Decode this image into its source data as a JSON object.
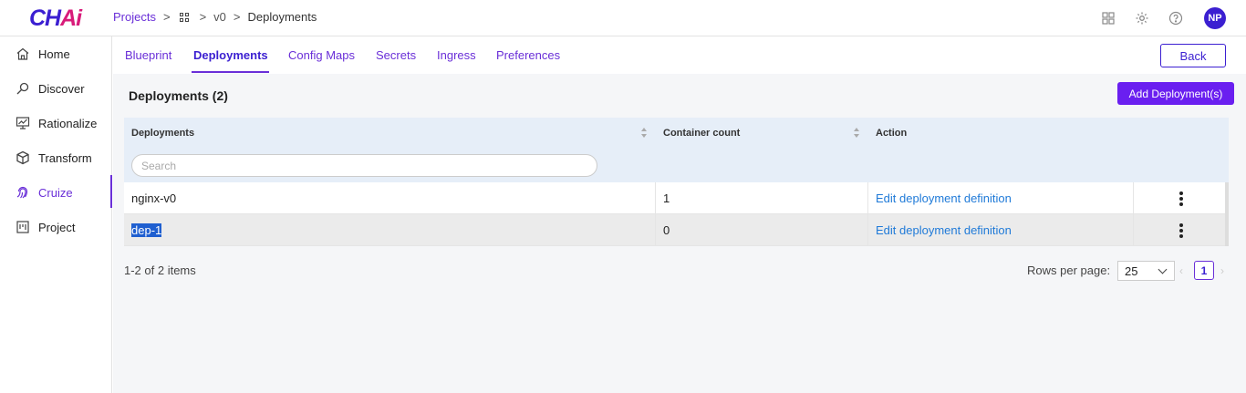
{
  "header": {
    "logo_main": "CH",
    "logo_accent": "Ai",
    "breadcrumb": {
      "projects": "Projects",
      "sep1": ">",
      "sep2": ">",
      "version": "v0",
      "sep3": ">",
      "current": "Deployments"
    },
    "avatar_initials": "NP"
  },
  "sidebar": {
    "items": [
      {
        "label": "Home",
        "icon": "home-icon"
      },
      {
        "label": "Discover",
        "icon": "discover-icon"
      },
      {
        "label": "Rationalize",
        "icon": "rationalize-icon"
      },
      {
        "label": "Transform",
        "icon": "transform-icon"
      },
      {
        "label": "Cruize",
        "icon": "cruize-icon",
        "active": true
      },
      {
        "label": "Project",
        "icon": "project-icon"
      }
    ]
  },
  "tabs": [
    {
      "label": "Blueprint"
    },
    {
      "label": "Deployments",
      "active": true
    },
    {
      "label": "Config Maps"
    },
    {
      "label": "Secrets"
    },
    {
      "label": "Ingress"
    },
    {
      "label": "Preferences"
    }
  ],
  "actions": {
    "back": "Back",
    "add": "Add Deployment(s)"
  },
  "section": {
    "title": "Deployments (2)"
  },
  "table": {
    "columns": [
      "Deployments",
      "Container count",
      "Action"
    ],
    "search_placeholder": "Search",
    "rows": [
      {
        "name": "nginx-v0",
        "count": "1",
        "action": "Edit deployment definition"
      },
      {
        "name": "dep-1",
        "count": "0",
        "action": "Edit deployment definition"
      }
    ]
  },
  "footer": {
    "item_count": "1-2 of 2 items",
    "rows_per_page_label": "Rows per page:",
    "rows_per_page_value": "25",
    "current_page": "1"
  },
  "colors": {
    "accent": "#6a2fd8",
    "primary": "#3b1fd1",
    "link": "#1f7ad8"
  }
}
